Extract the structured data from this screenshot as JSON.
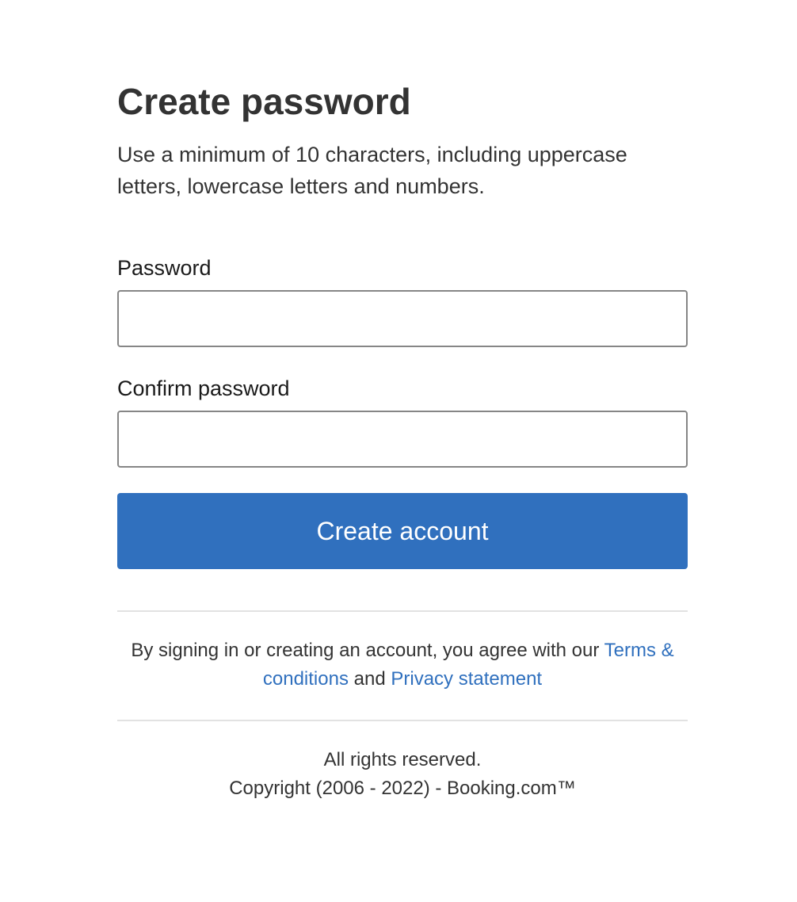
{
  "page": {
    "title": "Create password",
    "subtitle": "Use a minimum of 10 characters, including uppercase letters, lowercase letters and numbers."
  },
  "form": {
    "password_label": "Password",
    "password_value": "",
    "confirm_label": "Confirm password",
    "confirm_value": "",
    "submit_label": "Create account"
  },
  "legal": {
    "prefix": "By signing in or creating an account, you agree with our",
    "terms_link": "Terms & conditions",
    "conjunction": "and",
    "privacy_link": "Privacy statement"
  },
  "footer": {
    "rights": "All rights reserved.",
    "copyright": "Copyright (2006 - 2022) - Booking.com™"
  },
  "colors": {
    "accent": "#3070be",
    "text": "#333333",
    "border": "#868686",
    "divider": "#e2e2e2"
  }
}
